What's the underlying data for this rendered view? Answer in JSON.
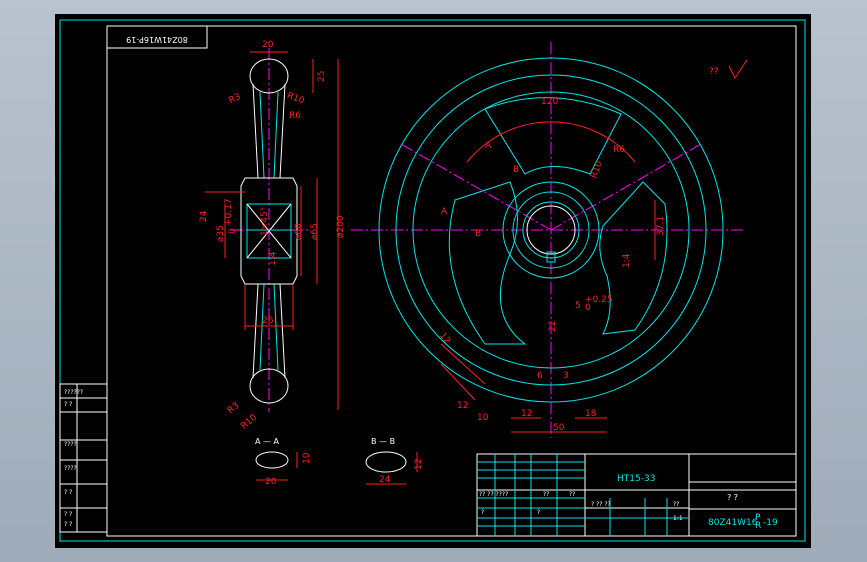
{
  "drawing": {
    "rotated_code": "80Z41W16P-19",
    "roughness_mark": "??",
    "side_view_dims": {
      "top_width": "20",
      "r3_top": "R3",
      "r10_top": "R10",
      "r6": "R6",
      "h25": "25",
      "d200": "⌀200",
      "d65": "⌀65",
      "d60": "⌀60",
      "d35": "⌀35",
      "tol_upper": "+0.17",
      "tol_lower": "0",
      "d24": "24",
      "chamfer": "1×45°",
      "slope": "1:4",
      "hub_width": "26",
      "r3_bottom": "R3",
      "r10_bottom": "R10"
    },
    "front_view_dims": {
      "angle": "120°",
      "a_label": "A",
      "b_label": "B",
      "r10": "R10",
      "r6": "R6",
      "d37_1": "37.1",
      "slope": "1:4",
      "d5": "5",
      "tol5": "+0.25",
      "tol5b": "0",
      "d22": "22",
      "d12a": "12",
      "d12b": "12",
      "d10": "10",
      "d6": "6",
      "d3": "3",
      "d12c": "12",
      "d18": "18",
      "d50": "50"
    },
    "sections": {
      "aa_label": "A — A",
      "aa_width": "20",
      "aa_height": "10",
      "bb_label": "B — B",
      "bb_width": "24",
      "bb_height": "12"
    },
    "side_table": {
      "rows": [
        "??????",
        "?  ?",
        "????",
        "????",
        "?  ?",
        "?  ?",
        "?  ?"
      ]
    },
    "title_block": {
      "material": "HT15-33",
      "name": "?   ?",
      "scale": "1:1",
      "code": "80Z41W16",
      "code_sup": "P",
      "code_sub": "R",
      "code_suffix": "-19",
      "row_label": "?? ?? ????",
      "c1": "??",
      "c2": "??",
      "q1": "?",
      "q2": "?",
      "q3": "? ?? ??",
      "q4": "??"
    }
  }
}
